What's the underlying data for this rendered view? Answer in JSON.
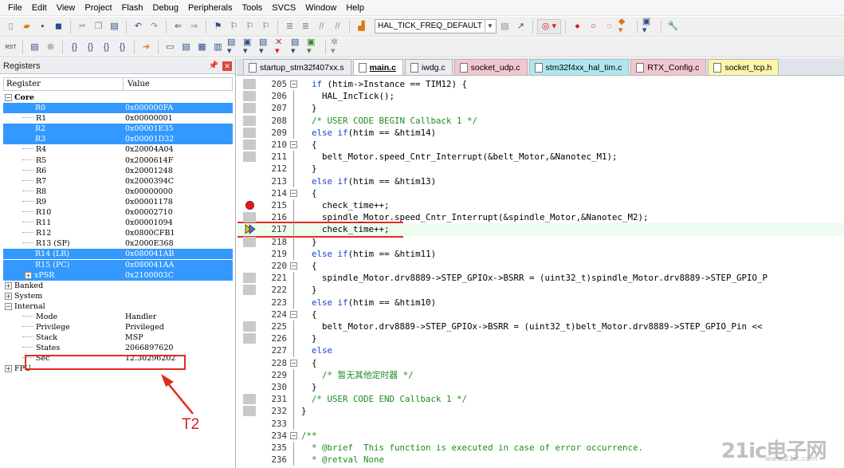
{
  "menubar": {
    "items": [
      "File",
      "Edit",
      "View",
      "Project",
      "Flash",
      "Debug",
      "Peripherals",
      "Tools",
      "SVCS",
      "Window",
      "Help"
    ]
  },
  "toolbar": {
    "target_select": "HAL_TICK_FREQ_DEFAULT",
    "rst_label": "RST"
  },
  "registers": {
    "panel_title": "Registers",
    "col_register": "Register",
    "col_value": "Value",
    "rows": [
      {
        "name": "Core",
        "value": "",
        "level": 0,
        "twisty": "−",
        "bold": true,
        "selected": false
      },
      {
        "name": "R0",
        "value": "0x000000FA",
        "level": 1,
        "selected": true
      },
      {
        "name": "R1",
        "value": "0x00000001",
        "level": 1,
        "selected": false
      },
      {
        "name": "R2",
        "value": "0x00001E35",
        "level": 1,
        "selected": true
      },
      {
        "name": "R3",
        "value": "0x00001D32",
        "level": 1,
        "selected": true
      },
      {
        "name": "R4",
        "value": "0x20004A04",
        "level": 1,
        "selected": false
      },
      {
        "name": "R5",
        "value": "0x2000614F",
        "level": 1,
        "selected": false
      },
      {
        "name": "R6",
        "value": "0x20001248",
        "level": 1,
        "selected": false
      },
      {
        "name": "R7",
        "value": "0x2000394C",
        "level": 1,
        "selected": false
      },
      {
        "name": "R8",
        "value": "0x00000000",
        "level": 1,
        "selected": false
      },
      {
        "name": "R9",
        "value": "0x00001178",
        "level": 1,
        "selected": false
      },
      {
        "name": "R10",
        "value": "0x00002710",
        "level": 1,
        "selected": false
      },
      {
        "name": "R11",
        "value": "0x00001094",
        "level": 1,
        "selected": false
      },
      {
        "name": "R12",
        "value": "0x0800CFB1",
        "level": 1,
        "selected": false
      },
      {
        "name": "R13 (SP)",
        "value": "0x2000E368",
        "level": 1,
        "selected": false
      },
      {
        "name": "R14 (LR)",
        "value": "0x080041AB",
        "level": 1,
        "selected": true
      },
      {
        "name": "R15 (PC)",
        "value": "0x080041AA",
        "level": 1,
        "selected": true
      },
      {
        "name": "xPSR",
        "value": "0x2100003C",
        "level": 1,
        "twisty": "+",
        "selected": true
      },
      {
        "name": "Banked",
        "value": "",
        "level": 0,
        "twisty": "+",
        "selected": false
      },
      {
        "name": "System",
        "value": "",
        "level": 0,
        "twisty": "+",
        "selected": false
      },
      {
        "name": "Internal",
        "value": "",
        "level": 0,
        "twisty": "−",
        "selected": false
      },
      {
        "name": "Mode",
        "value": "Handler",
        "level": 1,
        "selected": false
      },
      {
        "name": "Privilege",
        "value": "Privileged",
        "level": 1,
        "selected": false
      },
      {
        "name": "Stack",
        "value": "MSP",
        "level": 1,
        "selected": false
      },
      {
        "name": "States",
        "value": "2066897620",
        "level": 1,
        "selected": false
      },
      {
        "name": "Sec",
        "value": "12.30296202",
        "level": 1,
        "selected": false
      },
      {
        "name": "FPU",
        "value": "",
        "level": 0,
        "twisty": "+",
        "selected": false
      }
    ]
  },
  "annotation": {
    "label": "T2"
  },
  "tabs": [
    {
      "label": "startup_stm32f407xx.s",
      "color": "gray"
    },
    {
      "label": "main.c",
      "color": "white"
    },
    {
      "label": "iwdg.c",
      "color": "gray"
    },
    {
      "label": "socket_udp.c",
      "color": "pink"
    },
    {
      "label": "stm32f4xx_hal_tim.c",
      "color": "cyan"
    },
    {
      "label": "RTX_Config.c",
      "color": "pink"
    },
    {
      "label": "socket_tcp.h",
      "color": "yellow"
    }
  ],
  "code": {
    "lines": [
      {
        "num": "205",
        "text": "  if (htim->Instance == TIM12) {",
        "fold": "−",
        "gray": true
      },
      {
        "num": "206",
        "text": "    HAL_IncTick();",
        "gray": true
      },
      {
        "num": "207",
        "text": "  }",
        "gray": true
      },
      {
        "num": "208",
        "text": "  /* USER CODE BEGIN Callback 1 */",
        "gray": true
      },
      {
        "num": "209",
        "text": "  else if(htim == &htim14)",
        "gray": true
      },
      {
        "num": "210",
        "text": "  {",
        "fold": "−",
        "gray": true
      },
      {
        "num": "211",
        "text": "    belt_Motor.speed_Cntr_Interrupt(&belt_Motor,&Nanotec_M1);",
        "gray": true
      },
      {
        "num": "212",
        "text": "  }",
        "gray": false
      },
      {
        "num": "213",
        "text": "  else if(htim == &htim13)",
        "gray": false
      },
      {
        "num": "214",
        "text": "  {",
        "fold": "−",
        "gray": false
      },
      {
        "num": "215",
        "text": "    check_time++;",
        "gray": false,
        "breakpoint": true
      },
      {
        "num": "216",
        "text": "    spindle_Motor.speed_Cntr_Interrupt(&spindle_Motor,&Nanotec_M2);",
        "gray": true
      },
      {
        "num": "217",
        "text": "    check_time++;",
        "gray": false,
        "current": true
      },
      {
        "num": "218",
        "text": "  }",
        "gray": true
      },
      {
        "num": "219",
        "text": "  else if(htim == &htim11)",
        "gray": false
      },
      {
        "num": "220",
        "text": "  {",
        "fold": "−",
        "gray": false
      },
      {
        "num": "221",
        "text": "    spindle_Motor.drv8889->STEP_GPIOx->BSRR = (uint32_t)spindle_Motor.drv8889->STEP_GPIO_P",
        "gray": true
      },
      {
        "num": "222",
        "text": "  }",
        "gray": true
      },
      {
        "num": "223",
        "text": "  else if(htim == &htim10)",
        "gray": false
      },
      {
        "num": "224",
        "text": "  {",
        "fold": "−",
        "gray": false
      },
      {
        "num": "225",
        "text": "    belt_Motor.drv8889->STEP_GPIOx->BSRR = (uint32_t)belt_Motor.drv8889->STEP_GPIO_Pin <<",
        "gray": true
      },
      {
        "num": "226",
        "text": "  }",
        "gray": true
      },
      {
        "num": "227",
        "text": "  else",
        "gray": false
      },
      {
        "num": "228",
        "text": "  {",
        "fold": "−",
        "gray": false
      },
      {
        "num": "229",
        "text": "    /* 暂无其他定时器 */",
        "gray": false
      },
      {
        "num": "230",
        "text": "  }",
        "gray": false
      },
      {
        "num": "231",
        "text": "  /* USER CODE END Callback 1 */",
        "gray": true
      },
      {
        "num": "232",
        "text": "}",
        "gray": true
      },
      {
        "num": "233",
        "text": "",
        "gray": false
      },
      {
        "num": "234",
        "text": "/**",
        "fold": "−",
        "gray": false
      },
      {
        "num": "235",
        "text": "  * @brief  This function is executed in case of error occurrence.",
        "gray": false
      },
      {
        "num": "236",
        "text": "  * @retval None",
        "gray": false
      }
    ]
  },
  "watermark": {
    "main": "21ic电子网",
    "sub": "www.21ic.com"
  },
  "colors": {
    "selection": "#3399ff",
    "highlight_box": "#e02b20",
    "keyword": "#1d3fcf",
    "comment": "#1e8a1e"
  }
}
